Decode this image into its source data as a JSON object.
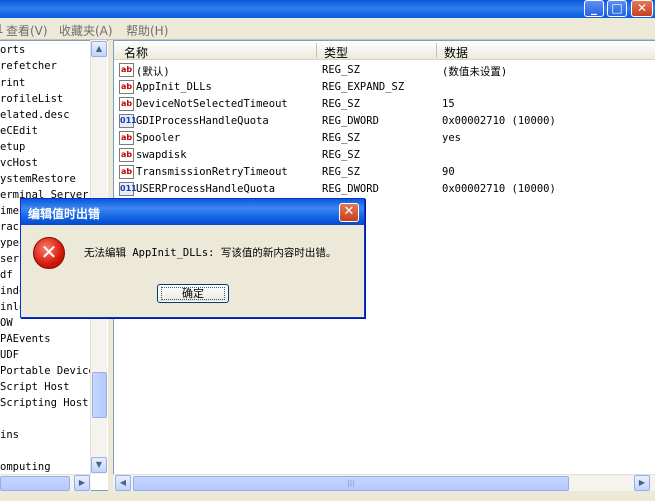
{
  "window": {
    "minimize_label": "_",
    "maximize_label": "□",
    "close_label": "✕"
  },
  "menu": {
    "items": [
      "查看(V)",
      "收藏夹(A)",
      "帮助(H)"
    ],
    "partial_left": "1"
  },
  "tree": {
    "items": [
      "orts",
      "refetcher",
      "rint",
      "rofileList",
      "elated.desc",
      "eCEdit",
      "etup",
      "vcHost",
      "ystemRestore",
      "erminal Server",
      "ime",
      "raci",
      "ype",
      "seri",
      "df",
      "indo",
      "inlo",
      "OW",
      "PAEvents",
      "UDF",
      "Portable Device",
      "Script Host",
      "Scripting Host",
      "",
      "ins",
      "",
      "omputing"
    ]
  },
  "list": {
    "columns": [
      "名称",
      "类型",
      "数据"
    ],
    "rows": [
      {
        "icon": "string-value-icon",
        "name": "(默认)",
        "type": "REG_SZ",
        "data": "(数值未设置)"
      },
      {
        "icon": "string-value-icon",
        "name": "AppInit_DLLs",
        "type": "REG_EXPAND_SZ",
        "data": ""
      },
      {
        "icon": "string-value-icon",
        "name": "DeviceNotSelectedTimeout",
        "type": "REG_SZ",
        "data": "15"
      },
      {
        "icon": "dword-value-icon",
        "name": "GDIProcessHandleQuota",
        "type": "REG_DWORD",
        "data": "0x00002710 (10000)"
      },
      {
        "icon": "string-value-icon",
        "name": "Spooler",
        "type": "REG_SZ",
        "data": "yes"
      },
      {
        "icon": "string-value-icon",
        "name": "swapdisk",
        "type": "REG_SZ",
        "data": ""
      },
      {
        "icon": "string-value-icon",
        "name": "TransmissionRetryTimeout",
        "type": "REG_SZ",
        "data": "90"
      },
      {
        "icon": "dword-value-icon",
        "name": "USERProcessHandleQuota",
        "type": "REG_DWORD",
        "data": "0x00002710 (10000)"
      }
    ]
  },
  "dialog": {
    "title": "编辑值时出错",
    "message": "无法编辑 AppInit_DLLs: 写该值的新内容时出错。",
    "ok_label": "确定",
    "close_label": "✕"
  },
  "icons": {
    "string_glyph": "ab",
    "dword_glyph": "011",
    "error_glyph": "✕"
  }
}
